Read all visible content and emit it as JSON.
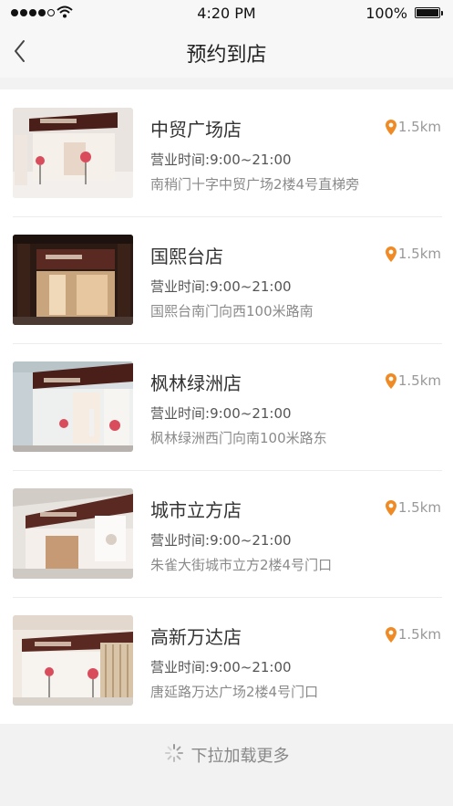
{
  "status_bar": {
    "time": "4:20 PM",
    "battery": "100%"
  },
  "header": {
    "title": "预约到店"
  },
  "stores": [
    {
      "name": "中贸广场店",
      "hours_label": "营业时间:",
      "hours": "9:00~21:00",
      "address": "南稍门十字中贸广场2楼4号直梯旁",
      "distance": "1.5km"
    },
    {
      "name": "国熙台店",
      "hours_label": "营业时间:",
      "hours": "9:00~21:00",
      "address": "国熙台南门向西100米路南",
      "distance": "1.5km"
    },
    {
      "name": "枫林绿洲店",
      "hours_label": "营业时间:",
      "hours": "9:00~21:00",
      "address": "枫林绿洲西门向南100米路东",
      "distance": "1.5km"
    },
    {
      "name": "城市立方店",
      "hours_label": "营业时间:",
      "hours": "9:00~21:00",
      "address": "朱雀大街城市立方2楼4号门口",
      "distance": "1.5km"
    },
    {
      "name": "高新万达店",
      "hours_label": "营业时间:",
      "hours": "9:00~21:00",
      "address": "唐延路万达广场2楼4号门口",
      "distance": "1.5km"
    }
  ],
  "footer": {
    "load_more": "下拉加载更多"
  },
  "colors": {
    "accent": "#f08a24",
    "brand_brown": "#5a2a22"
  }
}
